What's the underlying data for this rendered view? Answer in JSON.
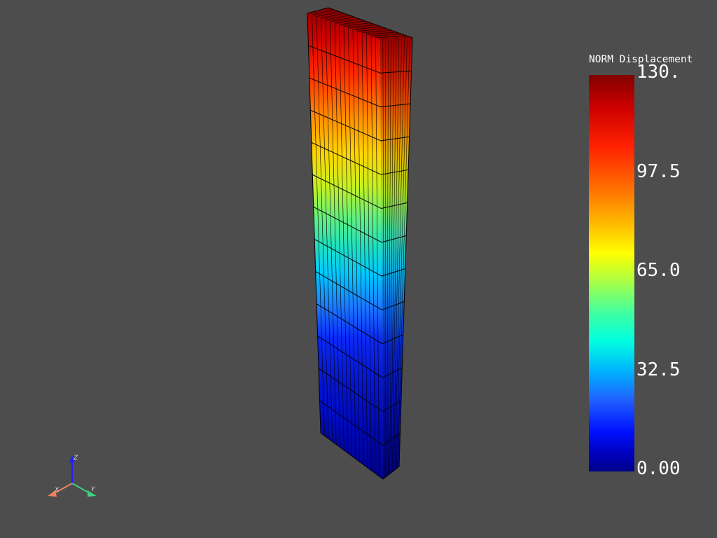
{
  "scalar_bar": {
    "title": "NORM Displacement",
    "labels": [
      "130.",
      "97.5",
      "65.0",
      "32.5",
      "0.00"
    ]
  },
  "axes": {
    "z": "Z",
    "x": "X",
    "y": "Y"
  }
}
